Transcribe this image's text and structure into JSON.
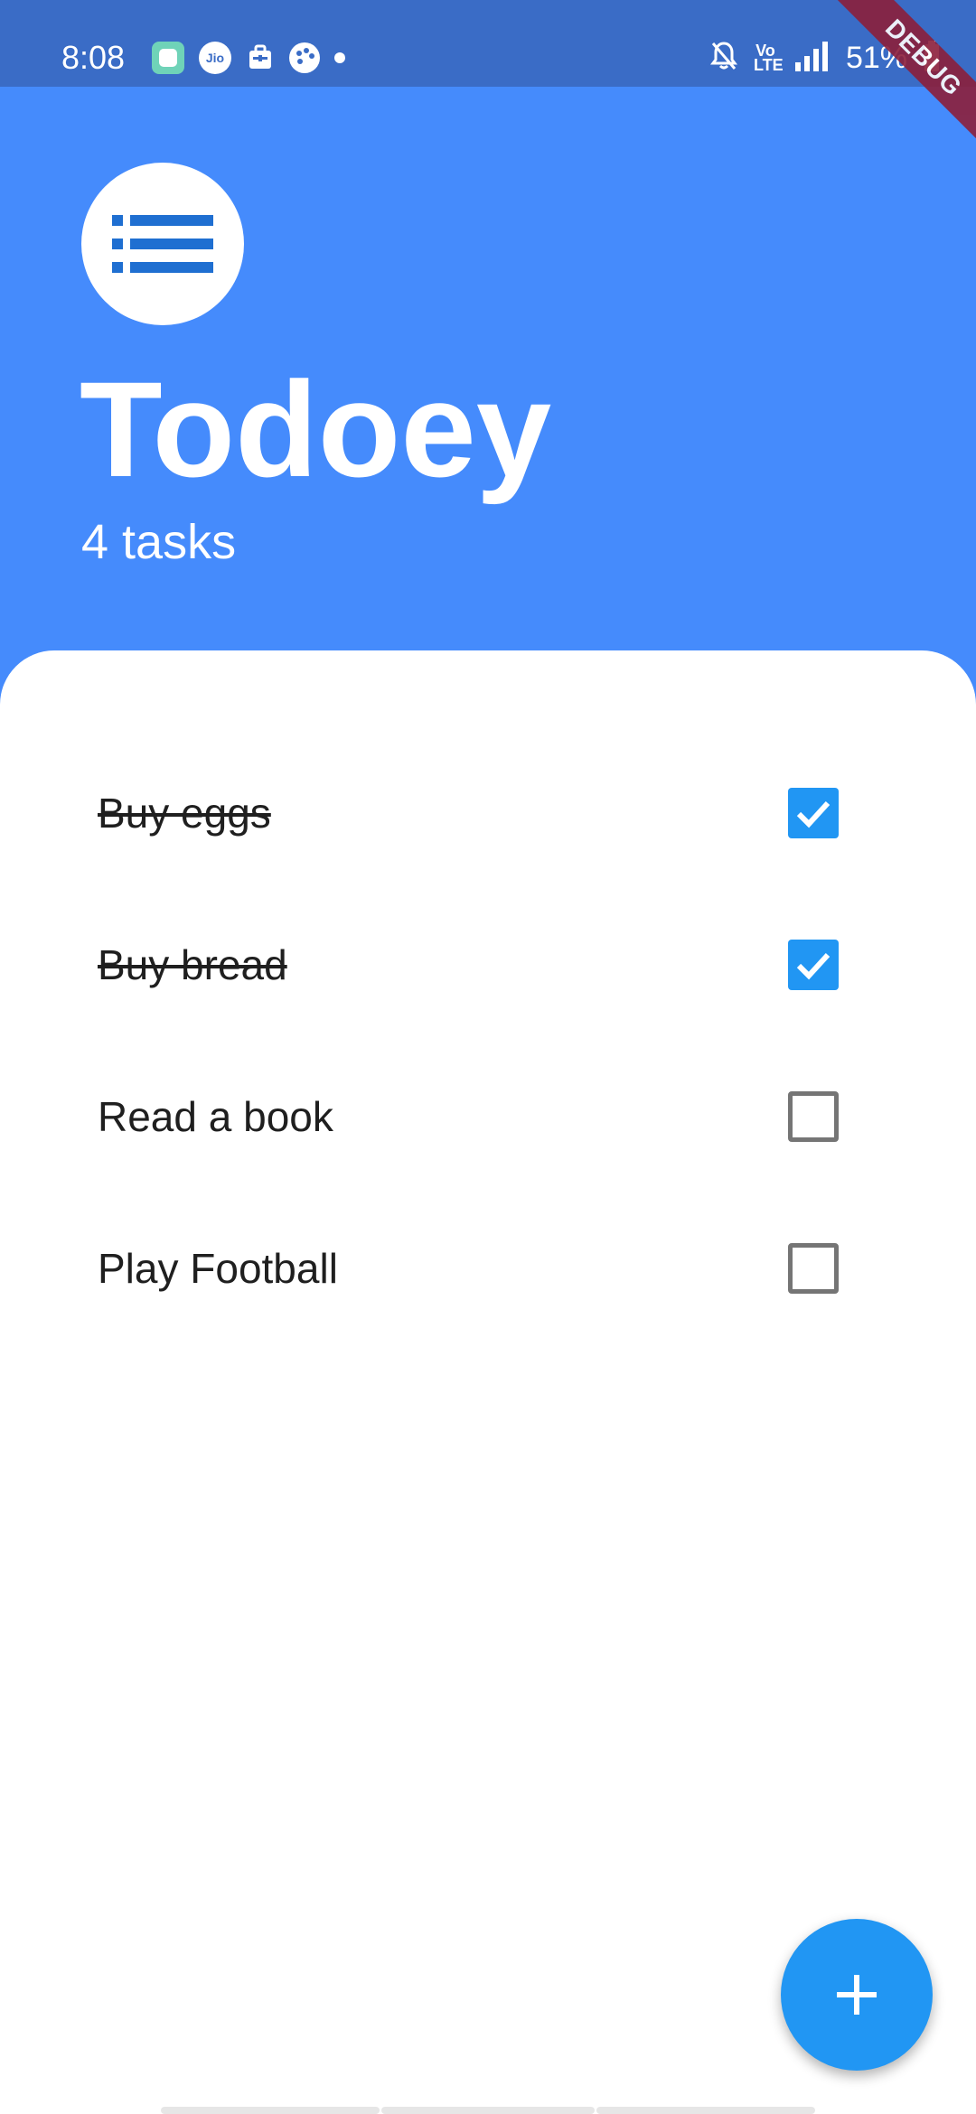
{
  "status_bar": {
    "time": "8:08",
    "jio_label": "Jio",
    "volte_label": "Vo\nLTE",
    "battery": "51%",
    "icons": [
      "app-icon",
      "jio-icon",
      "bag-icon",
      "palette-icon",
      "dot-icon",
      "mute-icon",
      "volte-icon",
      "signal-icon",
      "battery-icon"
    ]
  },
  "debug_banner": {
    "label": "DEBUG"
  },
  "header": {
    "logo_icon": "list-icon",
    "title": "Todoey",
    "subtitle": "4 tasks"
  },
  "tasks": [
    {
      "title": "Buy eggs",
      "done": true
    },
    {
      "title": "Buy bread",
      "done": true
    },
    {
      "title": "Read a book",
      "done": false
    },
    {
      "title": "Play Football",
      "done": false
    }
  ],
  "fab": {
    "icon": "plus-icon"
  },
  "colors": {
    "header_background": "#458bfc",
    "status_bar_background": "#3a6cc6",
    "accent": "#2196f3",
    "logo_icon": "#1f6fd1",
    "debug_banner": "#8c1f3b",
    "unchecked_border": "#757575"
  }
}
